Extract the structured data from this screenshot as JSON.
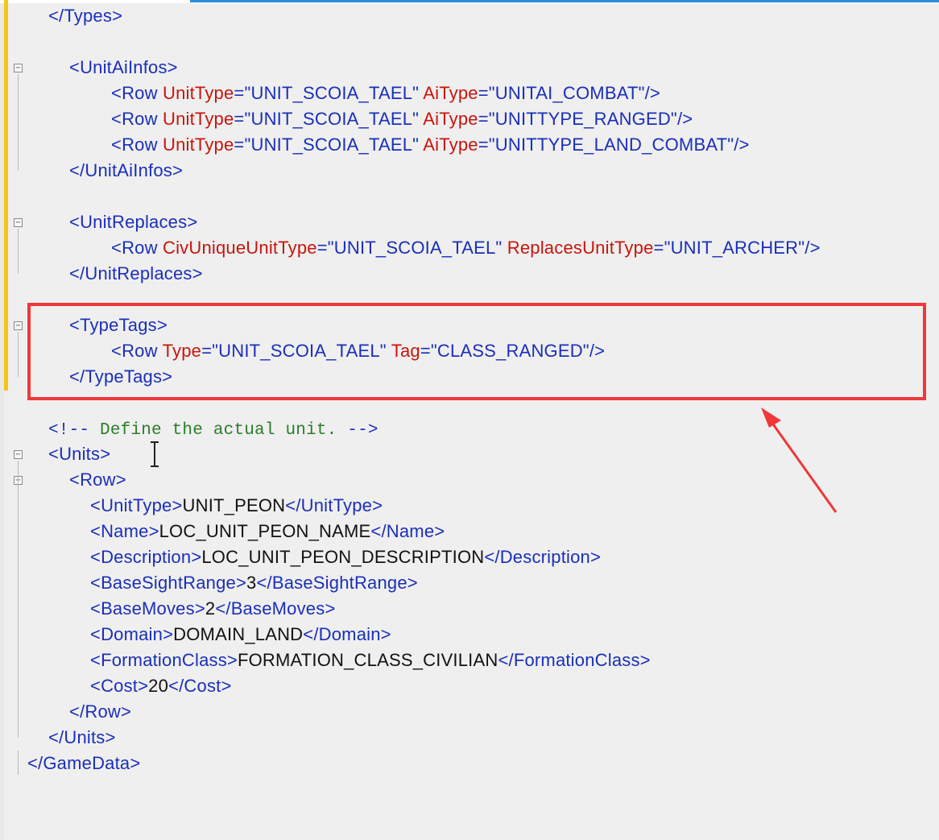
{
  "editor": {
    "language": "xml",
    "lines": [
      {
        "indent": 60,
        "fold": false,
        "parts": [
          [
            "b",
            "</"
          ],
          [
            "t",
            "Types"
          ],
          [
            "b",
            ">"
          ]
        ]
      },
      {
        "indent": 0,
        "fold": false,
        "parts": []
      },
      {
        "indent": 86,
        "fold": true,
        "parts": [
          [
            "b",
            "<"
          ],
          [
            "t",
            "UnitAiInfos"
          ],
          [
            "b",
            ">"
          ]
        ]
      },
      {
        "indent": 138,
        "fold": false,
        "parts": [
          [
            "b",
            "<"
          ],
          [
            "t",
            "Row "
          ],
          [
            "a",
            "UnitType"
          ],
          [
            "b",
            "="
          ],
          [
            "v",
            "\"UNIT_SCOIA_TAEL\" "
          ],
          [
            "a",
            "AiType"
          ],
          [
            "b",
            "="
          ],
          [
            "v",
            "\"UNITAI_COMBAT\""
          ],
          [
            "b",
            "/>"
          ]
        ]
      },
      {
        "indent": 138,
        "fold": false,
        "parts": [
          [
            "b",
            "<"
          ],
          [
            "t",
            "Row "
          ],
          [
            "a",
            "UnitType"
          ],
          [
            "b",
            "="
          ],
          [
            "v",
            "\"UNIT_SCOIA_TAEL\" "
          ],
          [
            "a",
            "AiType"
          ],
          [
            "b",
            "="
          ],
          [
            "v",
            "\"UNITTYPE_RANGED\""
          ],
          [
            "b",
            "/>"
          ]
        ]
      },
      {
        "indent": 138,
        "fold": false,
        "parts": [
          [
            "b",
            "<"
          ],
          [
            "t",
            "Row "
          ],
          [
            "a",
            "UnitType"
          ],
          [
            "b",
            "="
          ],
          [
            "v",
            "\"UNIT_SCOIA_TAEL\" "
          ],
          [
            "a",
            "AiType"
          ],
          [
            "b",
            "="
          ],
          [
            "v",
            "\"UNITTYPE_LAND_COMBAT\""
          ],
          [
            "b",
            "/>"
          ]
        ]
      },
      {
        "indent": 86,
        "fold": false,
        "parts": [
          [
            "b",
            "</"
          ],
          [
            "t",
            "UnitAiInfos"
          ],
          [
            "b",
            ">"
          ]
        ]
      },
      {
        "indent": 0,
        "fold": false,
        "parts": []
      },
      {
        "indent": 86,
        "fold": true,
        "parts": [
          [
            "b",
            "<"
          ],
          [
            "t",
            "UnitReplaces"
          ],
          [
            "b",
            ">"
          ]
        ]
      },
      {
        "indent": 138,
        "fold": false,
        "parts": [
          [
            "b",
            "<"
          ],
          [
            "t",
            "Row "
          ],
          [
            "a",
            "CivUniqueUnitType"
          ],
          [
            "b",
            "="
          ],
          [
            "v",
            "\"UNIT_SCOIA_TAEL\" "
          ],
          [
            "a",
            "ReplacesUnitType"
          ],
          [
            "b",
            "="
          ],
          [
            "v",
            "\"UNIT_ARCHER\""
          ],
          [
            "b",
            "/>"
          ]
        ]
      },
      {
        "indent": 86,
        "fold": false,
        "parts": [
          [
            "b",
            "</"
          ],
          [
            "t",
            "UnitReplaces"
          ],
          [
            "b",
            ">"
          ]
        ]
      },
      {
        "indent": 0,
        "fold": false,
        "parts": []
      },
      {
        "indent": 86,
        "fold": true,
        "parts": [
          [
            "b",
            "<"
          ],
          [
            "t",
            "TypeTags"
          ],
          [
            "b",
            ">"
          ]
        ]
      },
      {
        "indent": 138,
        "fold": false,
        "parts": [
          [
            "b",
            "<"
          ],
          [
            "t",
            "Row "
          ],
          [
            "a",
            "Type"
          ],
          [
            "b",
            "="
          ],
          [
            "v",
            "\"UNIT_SCOIA_TAEL\" "
          ],
          [
            "a",
            "Tag"
          ],
          [
            "b",
            "="
          ],
          [
            "v",
            "\"CLASS_RANGED\""
          ],
          [
            "b",
            "/>"
          ]
        ]
      },
      {
        "indent": 86,
        "fold": false,
        "parts": [
          [
            "b",
            "</"
          ],
          [
            "t",
            "TypeTags"
          ],
          [
            "b",
            ">"
          ]
        ]
      },
      {
        "indent": 0,
        "fold": false,
        "parts": []
      },
      {
        "indent": 60,
        "fold": false,
        "parts": [
          [
            "cmb",
            "<!-- "
          ],
          [
            "cm",
            "Define the actual unit."
          ],
          [
            "cmb",
            " -->"
          ]
        ]
      },
      {
        "indent": 60,
        "fold": true,
        "parts": [
          [
            "b",
            "<"
          ],
          [
            "t",
            "Units"
          ],
          [
            "b",
            ">"
          ]
        ]
      },
      {
        "indent": 86,
        "fold": true,
        "parts": [
          [
            "b",
            "<"
          ],
          [
            "t",
            "Row"
          ],
          [
            "b",
            ">"
          ]
        ]
      },
      {
        "indent": 112,
        "fold": false,
        "parts": [
          [
            "b",
            "<"
          ],
          [
            "t",
            "UnitType"
          ],
          [
            "b",
            ">"
          ],
          [
            "tx",
            "UNIT_PEON"
          ],
          [
            "b",
            "</"
          ],
          [
            "t",
            "UnitType"
          ],
          [
            "b",
            ">"
          ]
        ]
      },
      {
        "indent": 112,
        "fold": false,
        "parts": [
          [
            "b",
            "<"
          ],
          [
            "t",
            "Name"
          ],
          [
            "b",
            ">"
          ],
          [
            "tx",
            "LOC_UNIT_PEON_NAME"
          ],
          [
            "b",
            "</"
          ],
          [
            "t",
            "Name"
          ],
          [
            "b",
            ">"
          ]
        ]
      },
      {
        "indent": 112,
        "fold": false,
        "parts": [
          [
            "b",
            "<"
          ],
          [
            "t",
            "Description"
          ],
          [
            "b",
            ">"
          ],
          [
            "tx",
            "LOC_UNIT_PEON_DESCRIPTION"
          ],
          [
            "b",
            "</"
          ],
          [
            "t",
            "Description"
          ],
          [
            "b",
            ">"
          ]
        ]
      },
      {
        "indent": 112,
        "fold": false,
        "parts": [
          [
            "b",
            "<"
          ],
          [
            "t",
            "BaseSightRange"
          ],
          [
            "b",
            ">"
          ],
          [
            "tx",
            "3"
          ],
          [
            "b",
            "</"
          ],
          [
            "t",
            "BaseSightRange"
          ],
          [
            "b",
            ">"
          ]
        ]
      },
      {
        "indent": 112,
        "fold": false,
        "parts": [
          [
            "b",
            "<"
          ],
          [
            "t",
            "BaseMoves"
          ],
          [
            "b",
            ">"
          ],
          [
            "tx",
            "2"
          ],
          [
            "b",
            "</"
          ],
          [
            "t",
            "BaseMoves"
          ],
          [
            "b",
            ">"
          ]
        ]
      },
      {
        "indent": 112,
        "fold": false,
        "parts": [
          [
            "b",
            "<"
          ],
          [
            "t",
            "Domain"
          ],
          [
            "b",
            ">"
          ],
          [
            "tx",
            "DOMAIN_LAND"
          ],
          [
            "b",
            "</"
          ],
          [
            "t",
            "Domain"
          ],
          [
            "b",
            ">"
          ]
        ]
      },
      {
        "indent": 112,
        "fold": false,
        "parts": [
          [
            "b",
            "<"
          ],
          [
            "t",
            "FormationClass"
          ],
          [
            "b",
            ">"
          ],
          [
            "tx",
            "FORMATION_CLASS_CIVILIAN"
          ],
          [
            "b",
            "</"
          ],
          [
            "t",
            "FormationClass"
          ],
          [
            "b",
            ">"
          ]
        ]
      },
      {
        "indent": 112,
        "fold": false,
        "parts": [
          [
            "b",
            "<"
          ],
          [
            "t",
            "Cost"
          ],
          [
            "b",
            ">"
          ],
          [
            "tx",
            "20"
          ],
          [
            "b",
            "</"
          ],
          [
            "t",
            "Cost"
          ],
          [
            "b",
            ">"
          ]
        ]
      },
      {
        "indent": 86,
        "fold": false,
        "parts": [
          [
            "b",
            "</"
          ],
          [
            "t",
            "Row"
          ],
          [
            "b",
            ">"
          ]
        ]
      },
      {
        "indent": 60,
        "fold": false,
        "parts": [
          [
            "b",
            "</"
          ],
          [
            "t",
            "Units"
          ],
          [
            "b",
            ">"
          ]
        ]
      },
      {
        "indent": 34,
        "fold": false,
        "parts": [
          [
            "b",
            "</"
          ],
          [
            "t",
            "GameData"
          ],
          [
            "b",
            ">"
          ]
        ]
      }
    ]
  },
  "annotation": {
    "highlight_color": "#f0373a"
  }
}
